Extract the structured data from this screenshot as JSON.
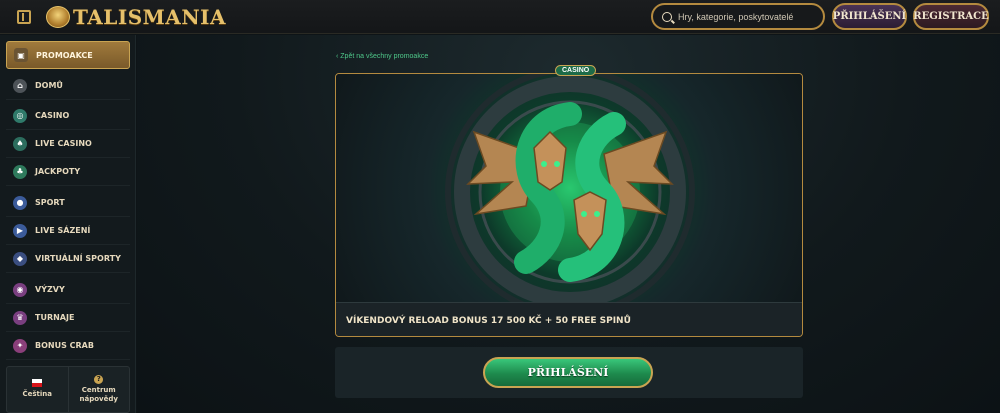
{
  "header": {
    "brand": "TALISMANIA",
    "search_placeholder": "Hry, kategorie, poskytovatelé",
    "login_label": "PŘIHLÁŠENÍ",
    "register_label": "REGISTRACE"
  },
  "sidebar": {
    "items": [
      {
        "label": "PROMOAKCE",
        "icon": "gift-icon"
      },
      {
        "label": "DOMŮ",
        "icon": "home-icon"
      },
      {
        "label": "CASINO",
        "icon": "casino-chip-icon"
      },
      {
        "label": "LIVE CASINO",
        "icon": "spade-icon"
      },
      {
        "label": "JACKPOTY",
        "icon": "clover-icon"
      },
      {
        "label": "SPORT",
        "icon": "football-icon"
      },
      {
        "label": "LIVE SÁZENÍ",
        "icon": "play-icon"
      },
      {
        "label": "VIRTUÁLNÍ SPORTY",
        "icon": "gamepad-icon"
      },
      {
        "label": "VÝZVY",
        "icon": "target-icon"
      },
      {
        "label": "TURNAJE",
        "icon": "trophy-icon"
      },
      {
        "label": "BONUS CRAB",
        "icon": "claw-icon"
      }
    ],
    "language_label": "Čeština",
    "help_label_1": "Centrum",
    "help_label_2": "nápovědy"
  },
  "main": {
    "back_link": "Zpět na všechny promoakce",
    "badge": "CASINO",
    "promo_title": "VÍKENDOVÝ RELOAD BONUS 17 500 KČ + 50 FREE SPINŮ",
    "cta_label": "PŘIHLÁŠENÍ"
  },
  "colors": {
    "accent_gold": "#c9a452",
    "cta_green": "#1e8a4d",
    "link_green": "#4fc88a",
    "background": "#0e1417"
  }
}
